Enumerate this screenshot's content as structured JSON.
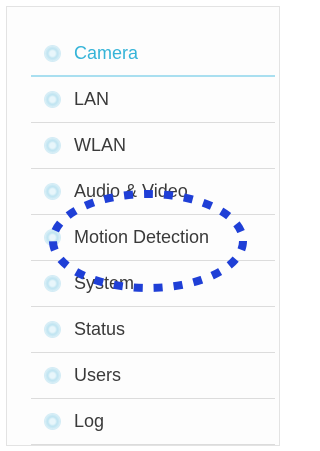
{
  "sidebar": {
    "items": [
      {
        "label": "Camera",
        "icon": "menu-bullet-icon",
        "active": true
      },
      {
        "label": "LAN",
        "icon": "menu-bullet-icon",
        "active": false
      },
      {
        "label": "WLAN",
        "icon": "menu-bullet-icon",
        "active": false
      },
      {
        "label": "Audio & Video",
        "icon": "menu-bullet-icon",
        "active": false
      },
      {
        "label": "Motion Detection",
        "icon": "menu-bullet-icon",
        "active": false
      },
      {
        "label": "System",
        "icon": "menu-bullet-icon",
        "active": false
      },
      {
        "label": "Status",
        "icon": "menu-bullet-icon",
        "active": false
      },
      {
        "label": "Users",
        "icon": "menu-bullet-icon",
        "active": false
      },
      {
        "label": "Log",
        "icon": "menu-bullet-icon",
        "active": false
      }
    ]
  },
  "colors": {
    "active_text": "#35b4d8",
    "text": "#3a3a3a",
    "annotation": "#1f3fd6"
  },
  "annotation": {
    "shape": "dotted-ellipse",
    "highlights": "Motion Detection"
  }
}
